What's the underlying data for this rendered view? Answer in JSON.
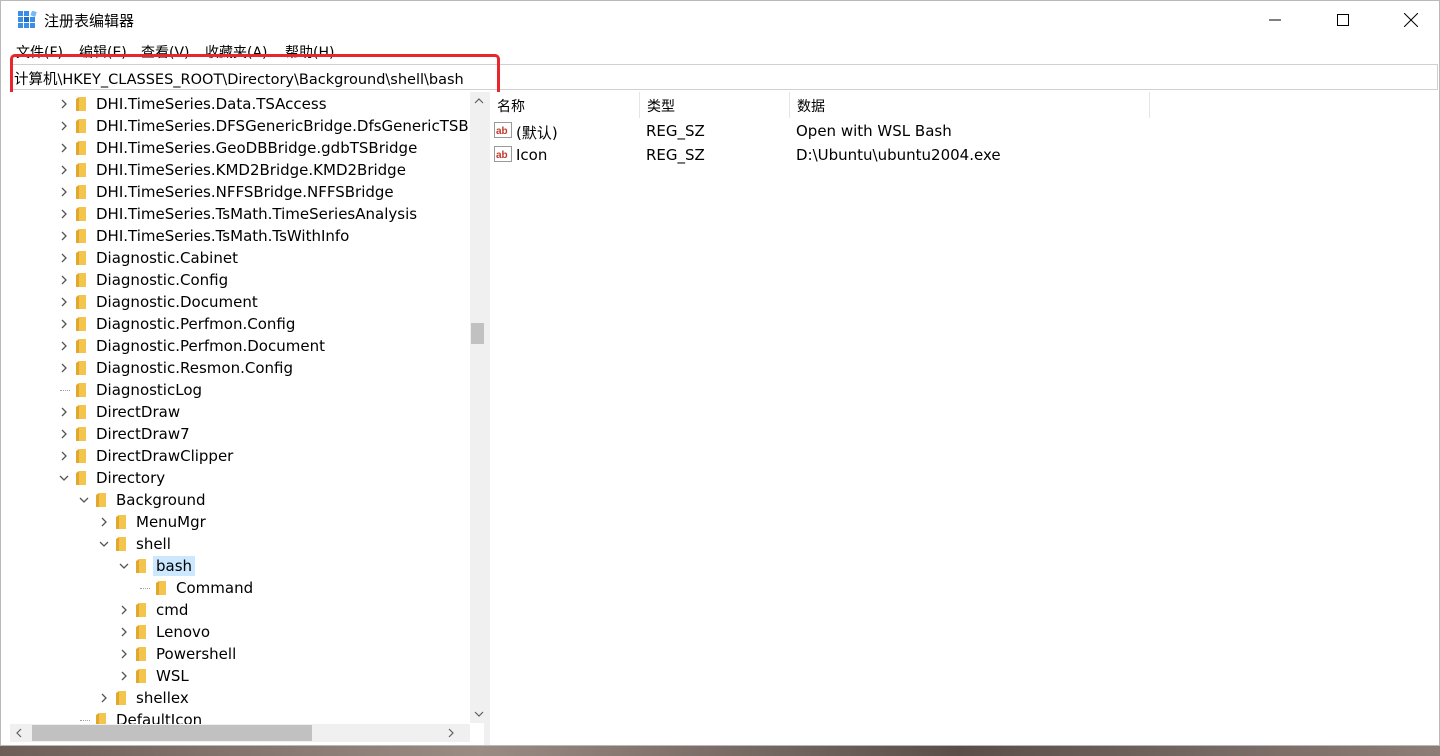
{
  "window": {
    "title": "注册表编辑器"
  },
  "menu": [
    "文件(F)",
    "编辑(E)",
    "查看(V)",
    "收藏夹(A)",
    "帮助(H)"
  ],
  "address": "计算机\\HKEY_CLASSES_ROOT\\Directory\\Background\\shell\\bash",
  "tree": [
    {
      "label": "DHI.TimeSeries.Data.TSAccess",
      "expand": "collapsed"
    },
    {
      "label": "DHI.TimeSeries.DFSGenericBridge.DfsGenericTSBr",
      "expand": "collapsed"
    },
    {
      "label": "DHI.TimeSeries.GeoDBBridge.gdbTSBridge",
      "expand": "collapsed"
    },
    {
      "label": "DHI.TimeSeries.KMD2Bridge.KMD2Bridge",
      "expand": "collapsed"
    },
    {
      "label": "DHI.TimeSeries.NFFSBridge.NFFSBridge",
      "expand": "collapsed"
    },
    {
      "label": "DHI.TimeSeries.TsMath.TimeSeriesAnalysis",
      "expand": "collapsed"
    },
    {
      "label": "DHI.TimeSeries.TsMath.TsWithInfo",
      "expand": "collapsed"
    },
    {
      "label": "Diagnostic.Cabinet",
      "expand": "collapsed"
    },
    {
      "label": "Diagnostic.Config",
      "expand": "collapsed"
    },
    {
      "label": "Diagnostic.Document",
      "expand": "collapsed"
    },
    {
      "label": "Diagnostic.Perfmon.Config",
      "expand": "collapsed"
    },
    {
      "label": "Diagnostic.Perfmon.Document",
      "expand": "collapsed"
    },
    {
      "label": "Diagnostic.Resmon.Config",
      "expand": "collapsed"
    },
    {
      "label": "DiagnosticLog",
      "expand": "none"
    },
    {
      "label": "DirectDraw",
      "expand": "collapsed"
    },
    {
      "label": "DirectDraw7",
      "expand": "collapsed"
    },
    {
      "label": "DirectDrawClipper",
      "expand": "collapsed"
    },
    {
      "label": "Directory",
      "expand": "expanded"
    },
    {
      "label": "Background",
      "expand": "expanded"
    },
    {
      "label": "MenuMgr",
      "expand": "collapsed"
    },
    {
      "label": "shell",
      "expand": "expanded"
    },
    {
      "label": "bash",
      "expand": "expanded"
    },
    {
      "label": "Command",
      "expand": "none"
    },
    {
      "label": "cmd",
      "expand": "collapsed"
    },
    {
      "label": "Lenovo",
      "expand": "collapsed"
    },
    {
      "label": "Powershell",
      "expand": "collapsed"
    },
    {
      "label": "WSL",
      "expand": "collapsed"
    },
    {
      "label": "shellex",
      "expand": "collapsed"
    },
    {
      "label": "DefaultIcon",
      "expand": "none"
    }
  ],
  "columns": [
    "名称",
    "类型",
    "数据"
  ],
  "values": [
    {
      "name": "(默认)",
      "type": "REG_SZ",
      "data": "Open with WSL Bash",
      "icon": "reg-string-icon"
    },
    {
      "name": "Icon",
      "type": "REG_SZ",
      "data": "D:\\Ubuntu\\ubuntu2004.exe",
      "icon": "reg-string-icon"
    }
  ],
  "selected_key": "bash",
  "colors": {
    "highlight": "#e8262b",
    "selection": "#cce8ff",
    "folder": "#f3c54c"
  }
}
